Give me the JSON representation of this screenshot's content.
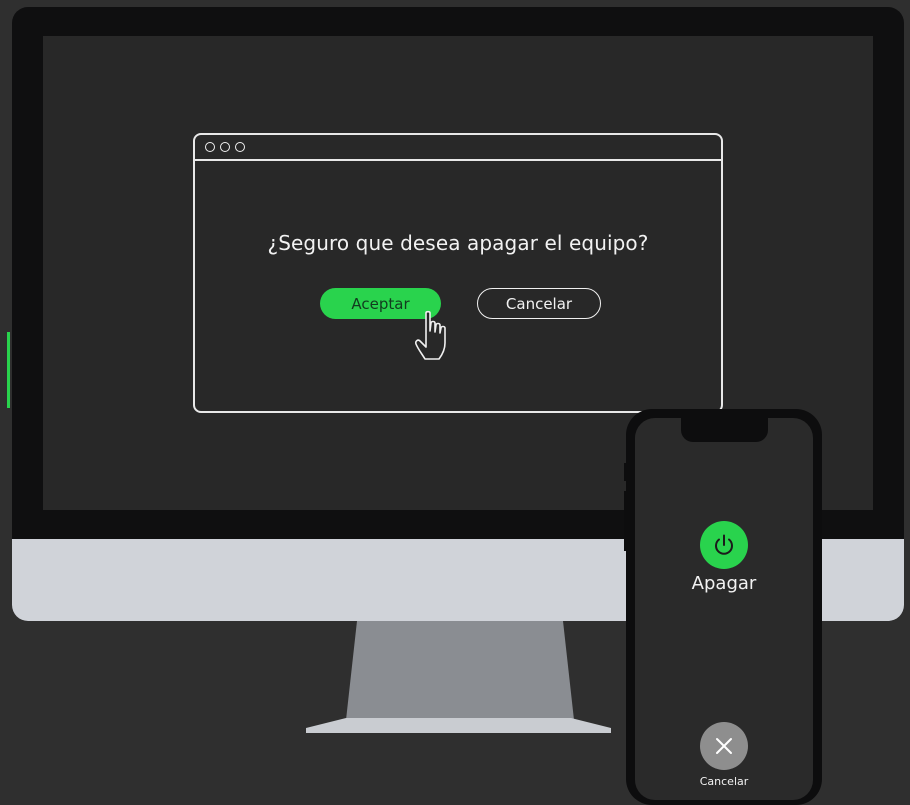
{
  "dialog": {
    "question": "¿Seguro que desea apagar el equipo?",
    "accept_label": "Aceptar",
    "cancel_label": "Cancelar"
  },
  "phone": {
    "power_label": "Apagar",
    "cancel_label": "Cancelar"
  },
  "colors": {
    "accent": "#29d34d",
    "background": "#2f2f2f",
    "screen": "#282828",
    "cancel_circle": "#8e8e8e"
  },
  "icons": [
    "power-icon",
    "close-icon",
    "pointer-hand-icon"
  ]
}
